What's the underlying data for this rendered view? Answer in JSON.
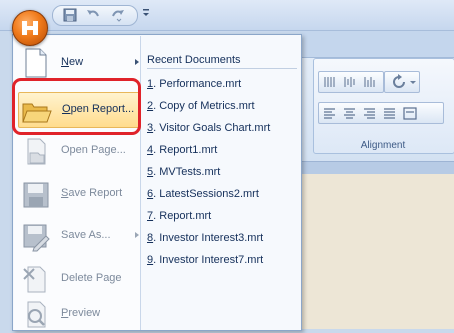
{
  "window": {
    "qat_icons": [
      "save-icon",
      "undo-icon",
      "redo-icon"
    ],
    "qat_more_icon": "customize-qat-icon"
  },
  "ribbon": {
    "group_label": "Alignment",
    "rotate_icon": "rotate-icon"
  },
  "app_menu": {
    "commands": [
      {
        "label": "New",
        "accel": "N",
        "rest": "ew",
        "icon": "new-document-icon",
        "has_submenu": true,
        "disabled": false
      },
      {
        "label": "Open Report...",
        "accel": "O",
        "rest": "pen Report...",
        "icon": "open-folder-icon",
        "has_submenu": false,
        "disabled": false
      },
      {
        "label": "Open Page...",
        "accel": "",
        "rest": "Open Page...",
        "icon": "open-page-icon",
        "has_submenu": false,
        "disabled": true
      },
      {
        "label": "Save Report",
        "accel": "S",
        "rest": "ave Report",
        "icon": "save-disk-icon",
        "has_submenu": false,
        "disabled": true
      },
      {
        "label": "Save As...",
        "accel": "",
        "rest": "Save As...",
        "icon": "save-as-icon",
        "has_submenu": true,
        "disabled": true
      },
      {
        "label": "Delete Page",
        "accel": "",
        "rest": "Delete Page",
        "icon": "delete-page-icon",
        "has_submenu": false,
        "disabled": true
      },
      {
        "label": "Preview",
        "accel": "P",
        "rest": "review",
        "icon": "preview-icon",
        "has_submenu": false,
        "disabled": true
      }
    ],
    "recent_title": "Recent Documents",
    "recent": [
      {
        "num": "1",
        "name": "Performance.mrt"
      },
      {
        "num": "2",
        "name": "Copy of Metrics.mrt"
      },
      {
        "num": "3",
        "name": "Visitor Goals Chart.mrt"
      },
      {
        "num": "4",
        "name": "Report1.mrt"
      },
      {
        "num": "5",
        "name": "MVTests.mrt"
      },
      {
        "num": "6",
        "name": "LatestSessions2.mrt"
      },
      {
        "num": "7",
        "name": "Report.mrt"
      },
      {
        "num": "8",
        "name": "Investor Interest3.mrt"
      },
      {
        "num": "9",
        "name": "Investor Interest7.mrt"
      }
    ]
  }
}
